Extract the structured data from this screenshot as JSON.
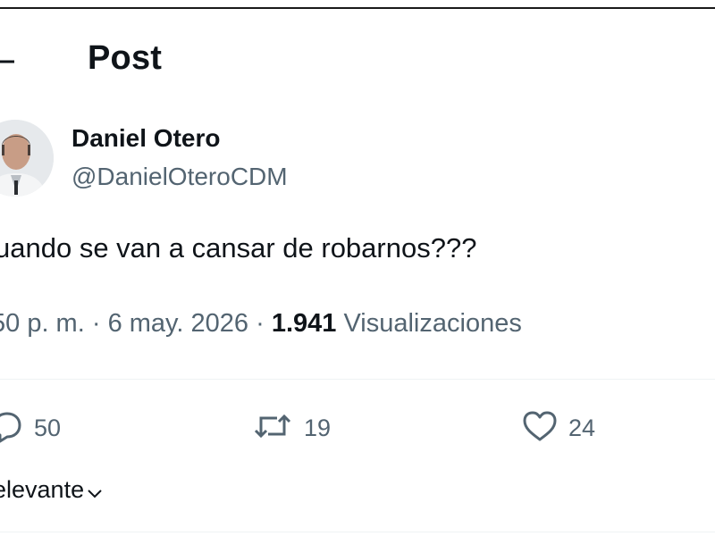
{
  "header": {
    "title": "Post"
  },
  "author": {
    "name": "Daniel Otero",
    "handle": "@DanielOteroCDM"
  },
  "post": {
    "text": "uando se van a cansar de robarnos???"
  },
  "meta": {
    "time": "50 p. m.",
    "separator": "·",
    "date": "6 may. 2026",
    "views_count": "1.941",
    "views_label": "Visualizaciones"
  },
  "actions": {
    "replies": "50",
    "reposts": "19",
    "likes": "24"
  },
  "sort": {
    "label": "elevante"
  },
  "icons": {
    "back": "arrow-left-icon",
    "reply": "reply-icon",
    "repost": "repost-icon",
    "like": "heart-icon",
    "chevron": "chevron-down-icon"
  },
  "colors": {
    "text": "#0f1419",
    "secondary": "#536471",
    "divider": "#eff3f4"
  }
}
